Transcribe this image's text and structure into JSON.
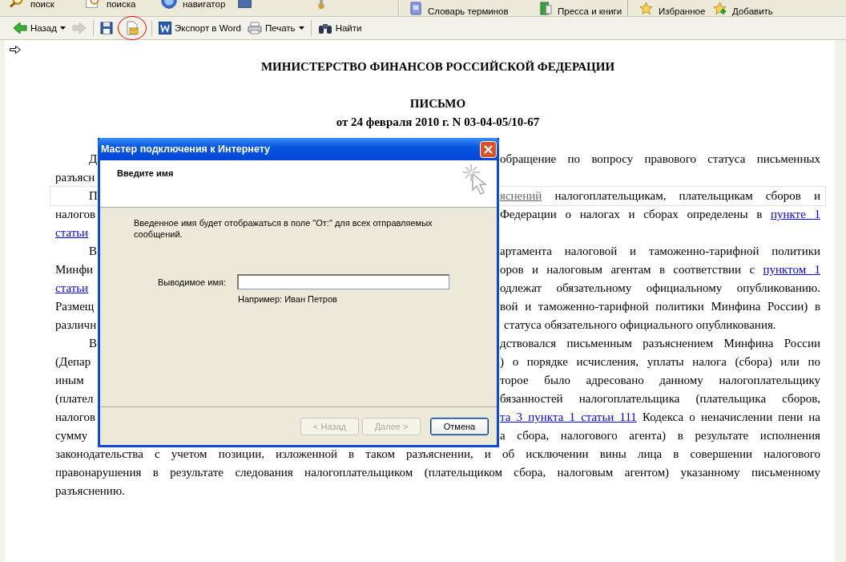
{
  "top_toolbar": {
    "left_items": [
      {
        "label": "поиск"
      },
      {
        "label": "поиска"
      },
      {
        "label": "навигатор"
      }
    ],
    "right_items": [
      {
        "label": "Словарь терминов"
      },
      {
        "label": "Пресса и книги"
      },
      {
        "label": "Избранное"
      },
      {
        "label": "Добавить"
      }
    ]
  },
  "nav_toolbar": {
    "buttons": [
      {
        "kind": "back",
        "label": "Назад",
        "disabled": false,
        "circled": false
      },
      {
        "kind": "forward",
        "disabled": true,
        "circled": false
      },
      {
        "kind": "save",
        "disabled": false,
        "circled": false
      },
      {
        "kind": "email",
        "disabled": false,
        "circled": true
      },
      {
        "kind": "word",
        "label": "Экспорт в Word",
        "disabled": false,
        "circled": false
      },
      {
        "kind": "print",
        "label": "Печать",
        "disabled": false,
        "circled": false
      },
      {
        "kind": "find",
        "label": "Найти",
        "disabled": false,
        "circled": false
      }
    ]
  },
  "document": {
    "headings": [
      "МИНИСТЕРСТВО ФИНАНСОВ РОССИЙСКОЙ ФЕДЕРАЦИИ",
      "ПИСЬМО",
      "от 24 февраля 2010 г. N 03-04-05/10-67"
    ],
    "lines": [
      {
        "kind": "split-first",
        "highlighted": false,
        "left": [
          {
            "kind": "text",
            "text": "Д"
          }
        ],
        "right": [
          {
            "kind": "text",
            "text": "обращение по вопросу правового статуса письменных"
          }
        ]
      },
      {
        "kind": "split",
        "highlighted": false,
        "left": [
          {
            "kind": "text",
            "text": "разъясн"
          }
        ]
      },
      {
        "kind": "split-first",
        "highlighted": true,
        "left": [
          {
            "kind": "text",
            "text": "П"
          }
        ],
        "right": [
          {
            "kind": "faded-link",
            "text": "яснений"
          },
          {
            "kind": "text",
            "text": " налогоплательщикам, плательщикам сборов и"
          }
        ]
      },
      {
        "kind": "split",
        "highlighted": false,
        "left": [
          {
            "kind": "text",
            "text": "налогов"
          }
        ],
        "right": [
          {
            "kind": "text",
            "text": "Федерации о налогах и сборах определены в "
          },
          {
            "kind": "link",
            "text": "пункте 1"
          }
        ]
      },
      {
        "kind": "split",
        "highlighted": false,
        "left": [
          {
            "kind": "link",
            "text": "статьи"
          }
        ]
      },
      {
        "kind": "split-first",
        "highlighted": false,
        "left": [
          {
            "kind": "text",
            "text": "В"
          }
        ],
        "right": [
          {
            "kind": "text",
            "text": "артамента налоговой и таможенно-тарифной политики"
          }
        ]
      },
      {
        "kind": "split",
        "highlighted": false,
        "left": [
          {
            "kind": "text",
            "text": "Минфи"
          }
        ],
        "right": [
          {
            "kind": "text",
            "text": "оров и налоговым агентам в соответствии с "
          },
          {
            "kind": "link",
            "text": "пунктом 1"
          }
        ]
      },
      {
        "kind": "split",
        "highlighted": false,
        "left": [
          {
            "kind": "link",
            "text": "статьи"
          }
        ],
        "right": [
          {
            "kind": "text",
            "text": "одлежат обязательному официальному опубликованию."
          }
        ]
      },
      {
        "kind": "split",
        "highlighted": false,
        "left": [
          {
            "kind": "text",
            "text": "Размещ"
          }
        ],
        "right": [
          {
            "kind": "text",
            "text": "вой и таможенно-тарифной политики Минфина России) в"
          }
        ]
      },
      {
        "kind": "split-end",
        "highlighted": false,
        "left": [
          {
            "kind": "text",
            "text": "различн"
          }
        ],
        "right": [
          {
            "kind": "text",
            "text": "статуса обязательного официального опубликования."
          }
        ]
      },
      {
        "kind": "split-first",
        "highlighted": false,
        "left": [
          {
            "kind": "text",
            "text": "В"
          }
        ],
        "right": [
          {
            "kind": "text",
            "text": "дствовался письменным разъяснением Минфина России"
          }
        ]
      },
      {
        "kind": "split",
        "highlighted": false,
        "left": [
          {
            "kind": "text",
            "text": "(Депар"
          }
        ],
        "right": [
          {
            "kind": "text",
            "text": ") о порядке исчисления, уплаты налога (сбора) или по"
          }
        ]
      },
      {
        "kind": "split",
        "highlighted": false,
        "left": [
          {
            "kind": "text",
            "text": "иным"
          }
        ],
        "right": [
          {
            "kind": "text",
            "text": "торое было адресовано данному налогоплательщику"
          }
        ]
      },
      {
        "kind": "split",
        "highlighted": false,
        "left": [
          {
            "kind": "text",
            "text": "(плател"
          }
        ],
        "right": [
          {
            "kind": "text",
            "text": "бязанностей налогоплательщика (плательщика сборов,"
          }
        ]
      },
      {
        "kind": "split",
        "highlighted": false,
        "left": [
          {
            "kind": "text",
            "text": "налогов"
          }
        ],
        "right": [
          {
            "kind": "link",
            "text": "та 3 пункта 1 статьи 111"
          },
          {
            "kind": "text",
            "text": " Кодекса о неначислении пени на"
          }
        ]
      },
      {
        "kind": "split",
        "highlighted": false,
        "left": [
          {
            "kind": "text",
            "text": "сумму"
          }
        ],
        "right": [
          {
            "kind": "text",
            "text": "а сбора, налогового агента) в результате исполнения"
          }
        ]
      },
      {
        "kind": "full",
        "highlighted": false,
        "left": [
          {
            "kind": "text",
            "text": "законодательства с учетом позиции, изложенной в таком разъяснении, и об исключении вины лица в совершении налогового"
          }
        ]
      },
      {
        "kind": "full",
        "highlighted": false,
        "left": [
          {
            "kind": "text",
            "text": "правонарушения в результате следования налогоплательщиком (плательщиком сбора, налоговым агентом) указанному письменному"
          }
        ]
      },
      {
        "kind": "full-end",
        "highlighted": false,
        "left": [
          {
            "kind": "text",
            "text": "разъяснению."
          }
        ]
      }
    ]
  },
  "dialog": {
    "title": "Мастер подключения к Интернету",
    "heading": "Введите имя",
    "description": "Введенное имя будет отображаться в поле \"От:\" для всех отправляемых сообщений.",
    "field": {
      "label": "Выводимое имя:",
      "hint": "Например: Иван Петров"
    },
    "buttons": [
      {
        "label": "< Назад",
        "disabled": true,
        "default": false
      },
      {
        "label": "Далее >",
        "disabled": true,
        "default": false
      },
      {
        "label": "Отмена",
        "disabled": false,
        "default": true
      }
    ]
  }
}
